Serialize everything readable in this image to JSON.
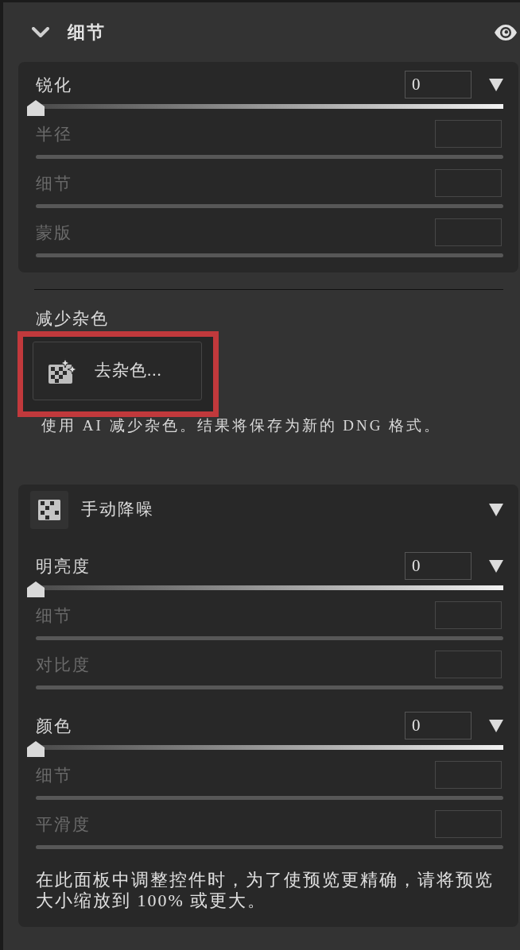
{
  "panel": {
    "title": "细节",
    "expanded": true
  },
  "sharpening": {
    "controls": [
      {
        "label": "锐化",
        "enabled": true,
        "value": "0",
        "level": 0
      },
      {
        "label": "半径",
        "enabled": false
      },
      {
        "label": "细节",
        "enabled": false
      },
      {
        "label": "蒙版",
        "enabled": false
      }
    ]
  },
  "noise_reduction": {
    "heading": "减少杂色",
    "button": {
      "label": "去杂色...",
      "highlighted": true
    },
    "description": "使用 AI 减少杂色。结果将保存为新的 DNG 格式。"
  },
  "manual_noise_reduction": {
    "title": "手动降噪",
    "groups": [
      {
        "controls": [
          {
            "label": "明亮度",
            "enabled": true,
            "value": "0",
            "level": 0
          },
          {
            "label": "细节",
            "enabled": false
          },
          {
            "label": "对比度",
            "enabled": false
          }
        ]
      },
      {
        "controls": [
          {
            "label": "颜色",
            "enabled": true,
            "value": "0",
            "level": 0
          },
          {
            "label": "细节",
            "enabled": false
          },
          {
            "label": "平滑度",
            "enabled": false
          }
        ]
      }
    ]
  },
  "note": "在此面板中调整控件时，为了使预览更精确，请将预览大小缩放到 100% 或更大。"
}
